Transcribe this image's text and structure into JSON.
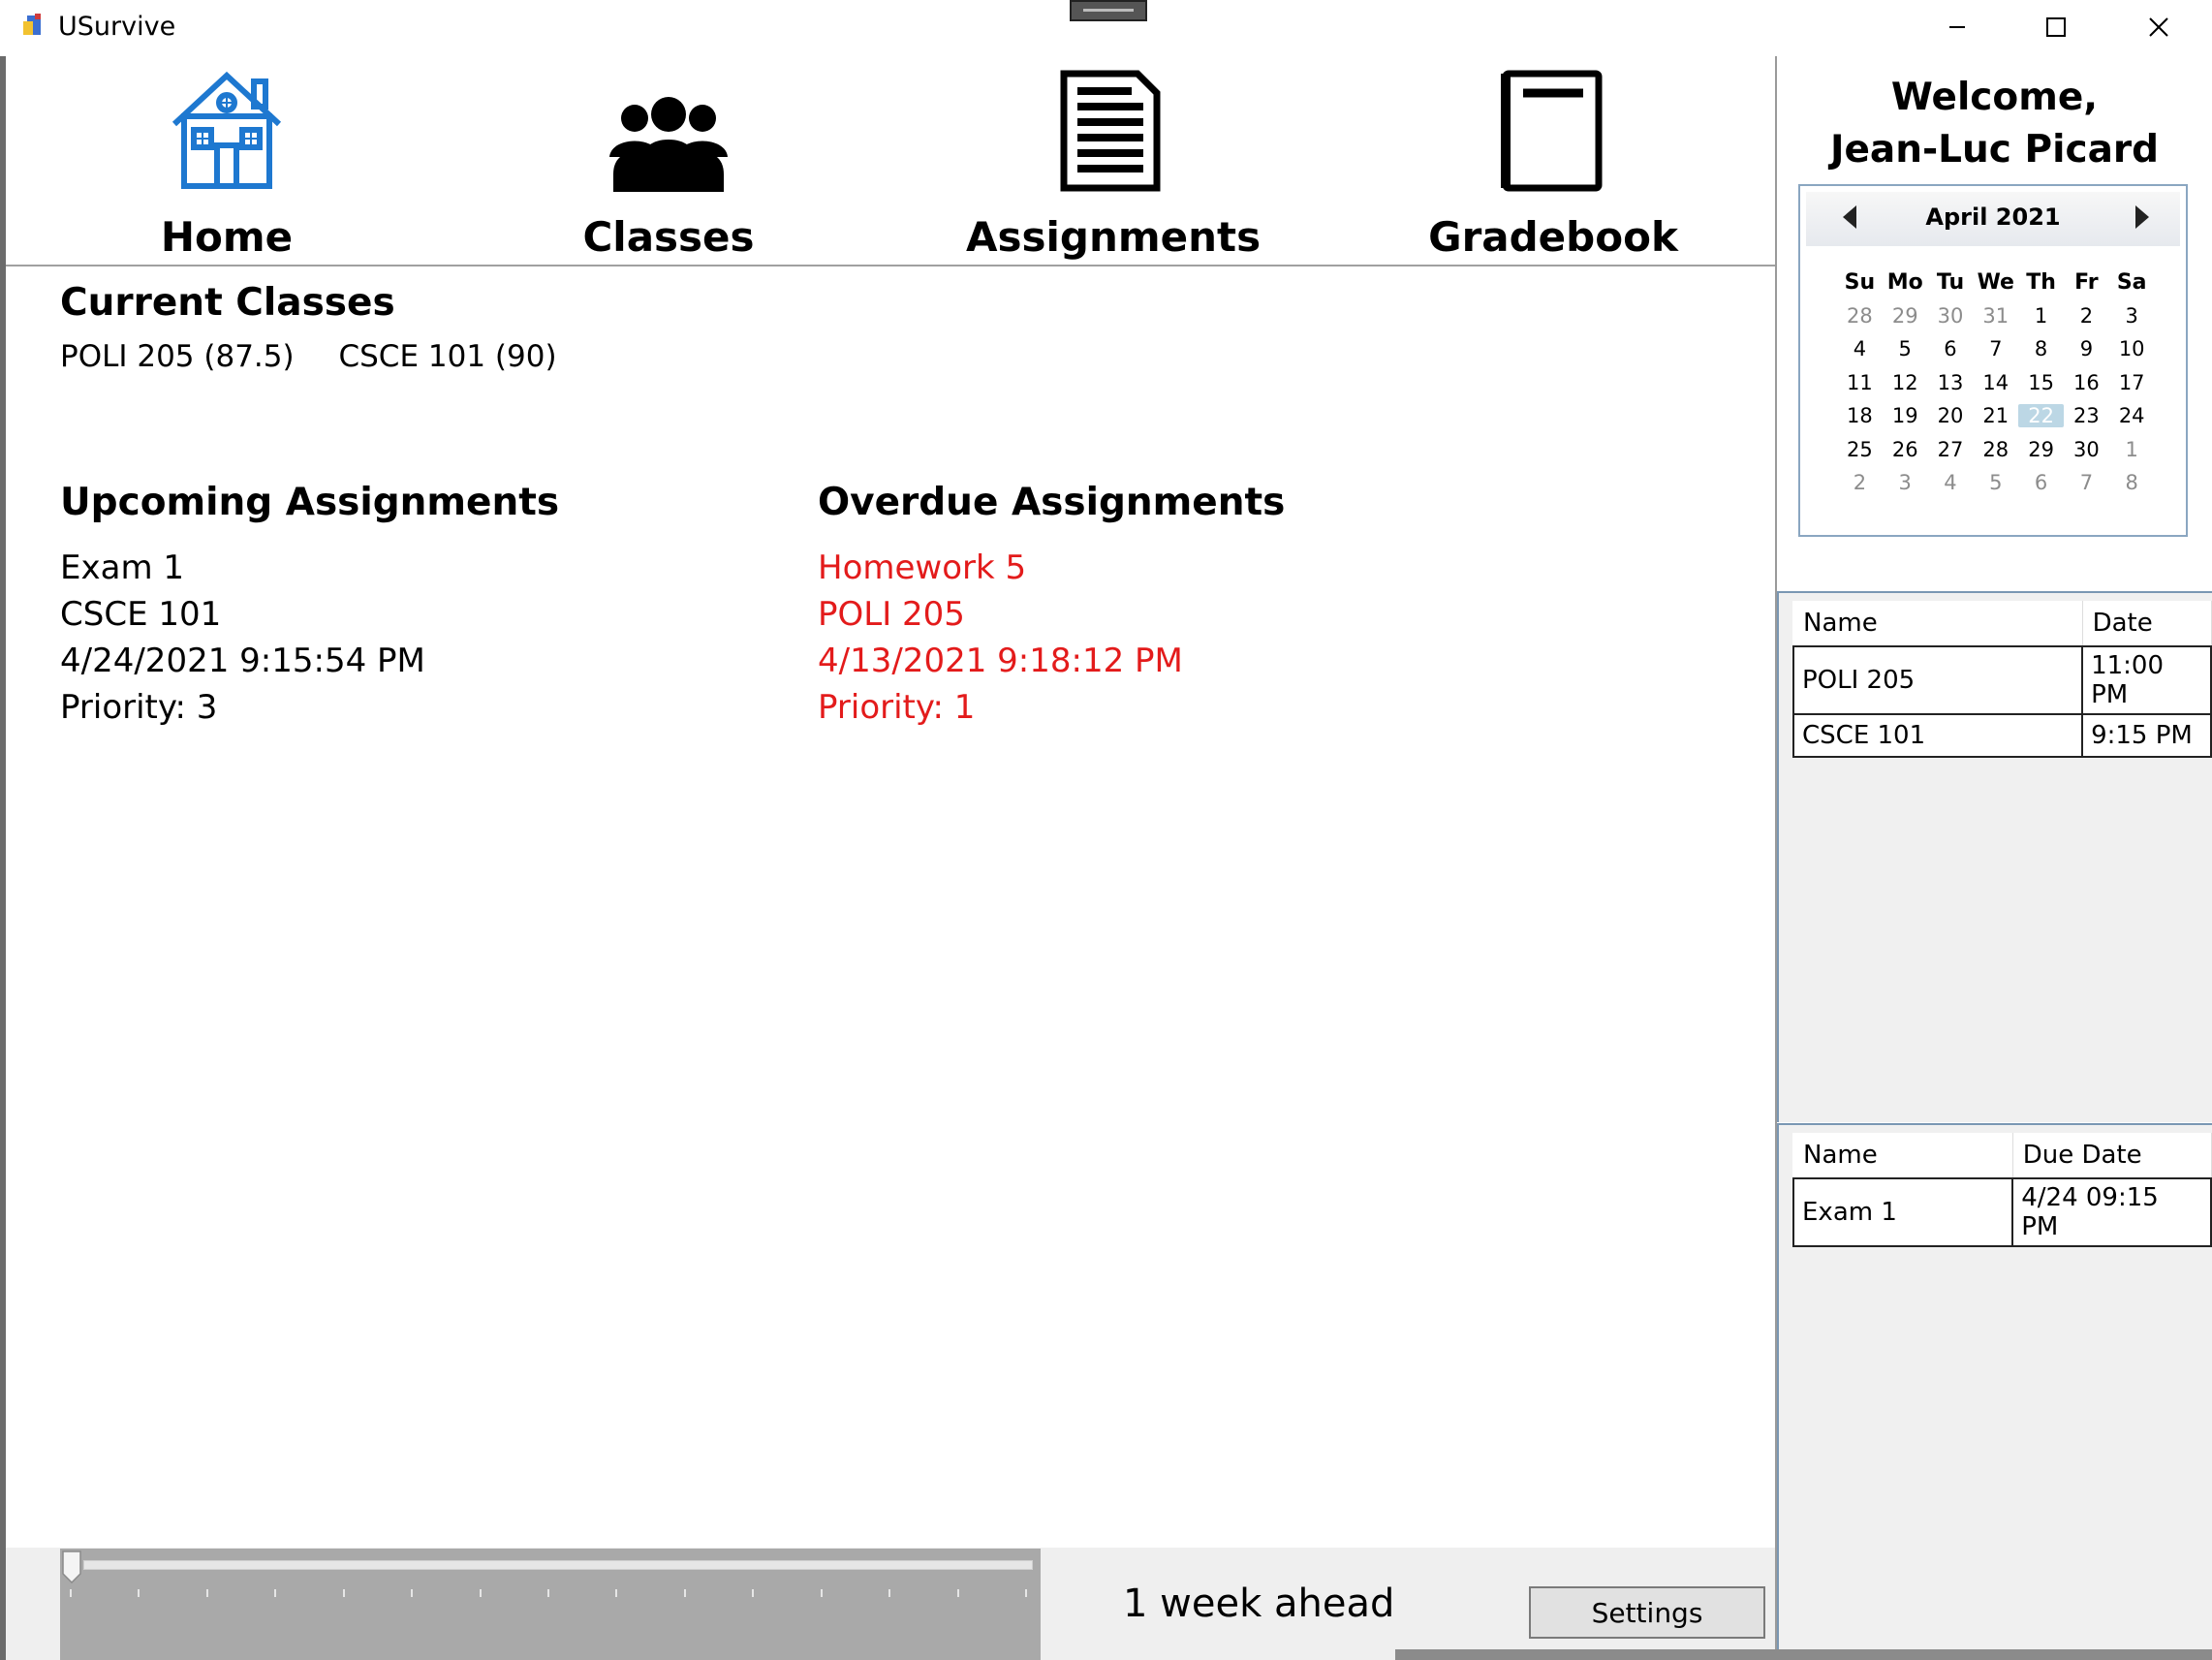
{
  "window": {
    "title": "USurvive",
    "controls": [
      "minimize",
      "maximize",
      "close"
    ]
  },
  "nav": [
    {
      "label": "Home",
      "icon": "house-icon",
      "color": "#1e78d0"
    },
    {
      "label": "Classes",
      "icon": "people-group-icon",
      "color": "#000000"
    },
    {
      "label": "Assignments",
      "icon": "document-lines-icon",
      "color": "#000000"
    },
    {
      "label": "Gradebook",
      "icon": "book-icon",
      "color": "#000000"
    }
  ],
  "main": {
    "current_classes_heading": "Current Classes",
    "current_classes": [
      "POLI 205 (87.5)",
      "CSCE 101 (90)"
    ],
    "upcoming_heading": "Upcoming Assignments",
    "upcoming": {
      "name": "Exam 1",
      "class": "CSCE 101",
      "due": "4/24/2021 9:15:54 PM",
      "priority": "Priority: 3"
    },
    "overdue_heading": "Overdue Assignments",
    "overdue": {
      "name": "Homework 5",
      "class": "POLI 205",
      "due": "4/13/2021 9:18:12 PM",
      "priority": "Priority: 1",
      "color": "#e31b1b"
    }
  },
  "bottom": {
    "slider_position": 0,
    "weeks_label": "1 week ahead",
    "settings_label": "Settings"
  },
  "sidebar": {
    "welcome_line1": "Welcome,",
    "welcome_line2": "Jean-Luc Picard",
    "calendar": {
      "month": "April 2021",
      "days_of_week": [
        "Su",
        "Mo",
        "Tu",
        "We",
        "Th",
        "Fr",
        "Sa"
      ],
      "weeks": [
        [
          "28",
          "29",
          "30",
          "31",
          "1",
          "2",
          "3"
        ],
        [
          "4",
          "5",
          "6",
          "7",
          "8",
          "9",
          "10"
        ],
        [
          "11",
          "12",
          "13",
          "14",
          "15",
          "16",
          "17"
        ],
        [
          "18",
          "19",
          "20",
          "21",
          "22",
          "23",
          "24"
        ],
        [
          "25",
          "26",
          "27",
          "28",
          "29",
          "30",
          "1"
        ],
        [
          "2",
          "3",
          "4",
          "5",
          "6",
          "7",
          "8"
        ]
      ],
      "selected": "22"
    },
    "events_table": {
      "headers": [
        "Name",
        "Date"
      ],
      "rows": [
        [
          "POLI 205",
          "11:00 PM"
        ],
        [
          "CSCE 101",
          "9:15 PM"
        ]
      ]
    },
    "assignments_table": {
      "headers": [
        "Name",
        "Due Date"
      ],
      "rows": [
        [
          "Exam 1",
          "4/24 09:15 PM"
        ]
      ]
    }
  }
}
